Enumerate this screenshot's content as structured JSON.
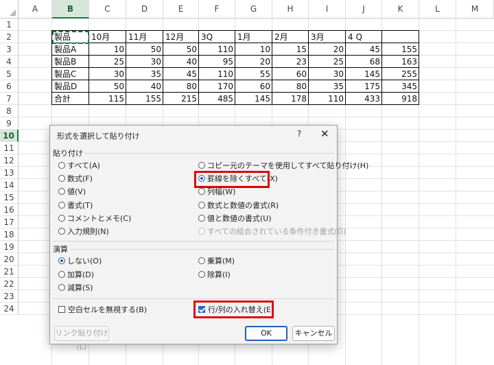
{
  "columns": [
    "A",
    "B",
    "C",
    "D",
    "E",
    "F",
    "G",
    "H",
    "I",
    "J",
    "K",
    "L",
    "M"
  ],
  "selected_column": "B",
  "rows": [
    "1",
    "2",
    "3",
    "4",
    "5",
    "6",
    "7",
    "8",
    "9",
    "10",
    "11",
    "12",
    "13",
    "14",
    "15",
    "16",
    "17",
    "18",
    "19",
    "20",
    "21",
    "22",
    "23",
    "24"
  ],
  "selected_row": "10",
  "table": {
    "header": [
      "製品",
      "10月",
      "11月",
      "12月",
      "3Q",
      "1月",
      "2月",
      "3月",
      "4 Q",
      ""
    ],
    "rows": [
      [
        "製品A",
        "10",
        "50",
        "50",
        "110",
        "10",
        "15",
        "20",
        "45",
        "155"
      ],
      [
        "製品B",
        "25",
        "30",
        "40",
        "95",
        "20",
        "23",
        "25",
        "68",
        "163"
      ],
      [
        "製品C",
        "30",
        "35",
        "45",
        "110",
        "55",
        "60",
        "30",
        "145",
        "255"
      ],
      [
        "製品D",
        "50",
        "40",
        "80",
        "170",
        "60",
        "80",
        "35",
        "175",
        "345"
      ],
      [
        "合計",
        "115",
        "155",
        "215",
        "485",
        "145",
        "178",
        "110",
        "433",
        "918"
      ]
    ]
  },
  "dialog": {
    "title": "形式を選択して貼り付け",
    "help": "?",
    "close": "✕",
    "paste_section": "貼り付け",
    "paste_left": [
      {
        "label": "すべて(A)",
        "checked": false
      },
      {
        "label": "数式(F)",
        "checked": false
      },
      {
        "label": "値(V)",
        "checked": false
      },
      {
        "label": "書式(T)",
        "checked": false
      },
      {
        "label": "コメントとメモ(C)",
        "checked": false
      },
      {
        "label": "入力規則(N)",
        "checked": false
      }
    ],
    "paste_right": [
      {
        "label": "コピー元のテーマを使用してすべて貼り付け(H)",
        "checked": false,
        "disabled": false
      },
      {
        "label": "罫線を除くすべて(X)",
        "checked": true,
        "disabled": false
      },
      {
        "label": "列幅(W)",
        "checked": false,
        "disabled": false
      },
      {
        "label": "数式と数値の書式(R)",
        "checked": false,
        "disabled": false
      },
      {
        "label": "値と数値の書式(U)",
        "checked": false,
        "disabled": false
      },
      {
        "label": "すべての結合されている条件付き書式(G)",
        "checked": false,
        "disabled": true
      }
    ],
    "operation_section": "演算",
    "op_left": [
      {
        "label": "しない(O)",
        "checked": true
      },
      {
        "label": "加算(D)",
        "checked": false
      },
      {
        "label": "減算(S)",
        "checked": false
      }
    ],
    "op_right": [
      {
        "label": "乗算(M)",
        "checked": false
      },
      {
        "label": "除算(I)",
        "checked": false
      }
    ],
    "skip_blanks": {
      "label": "空白セルを無視する(B)",
      "checked": false
    },
    "transpose": {
      "label": "行/列の入れ替え(E)",
      "checked": true
    },
    "paste_link": "リンク貼り付け(L)",
    "ok": "OK",
    "cancel": "キャンセル"
  }
}
